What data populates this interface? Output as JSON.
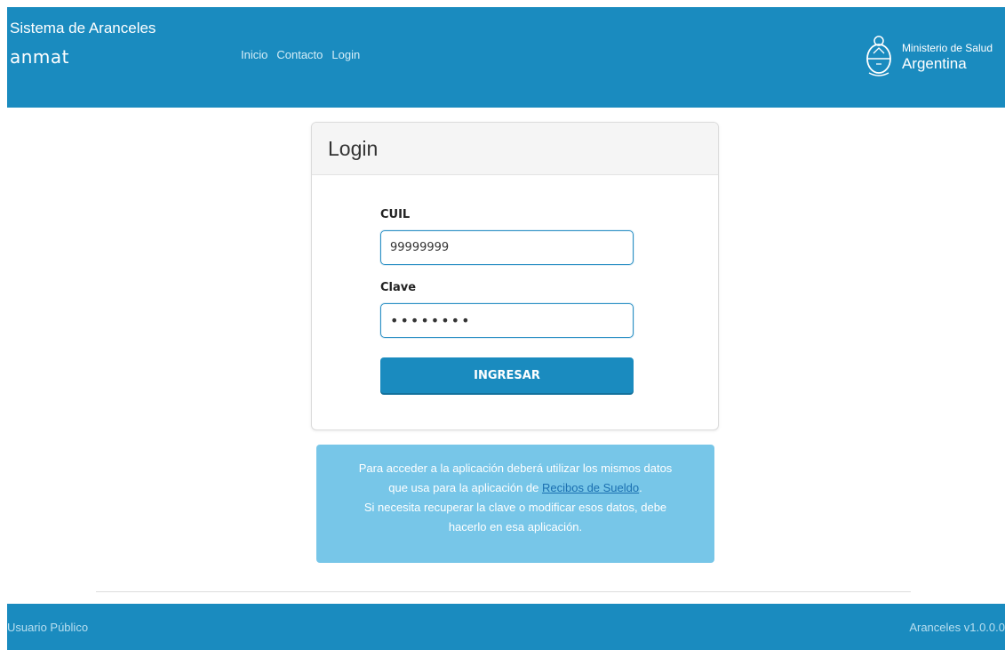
{
  "header": {
    "title": "Sistema de Aranceles",
    "logo_text": "anmat",
    "nav": [
      "Inicio",
      "Contacto",
      "Login"
    ],
    "ministerio_line1": "Ministerio de Salud",
    "ministerio_line2": "Argentina"
  },
  "login": {
    "title": "Login",
    "cuil_label": "CUIL",
    "cuil_value": "99999999",
    "clave_label": "Clave",
    "clave_value": "••••••••",
    "submit_label": "INGRESAR"
  },
  "info": {
    "line1": "Para acceder a la aplicación deberá utilizar los mismos datos",
    "line2_pre": "que usa para la aplicación de ",
    "line2_link": "Recibos de Sueldo",
    "line2_post": ".",
    "line3": "Si necesita recuperar la clave o modificar esos datos, debe",
    "line4": "hacerlo en esa aplicación."
  },
  "footer": {
    "user": "Usuario Público",
    "version": "Aranceles v1.0.0.0"
  },
  "colors": {
    "primary": "#1a8bbf",
    "info_bg": "#77c6e8",
    "link": "#1a6fb0"
  }
}
